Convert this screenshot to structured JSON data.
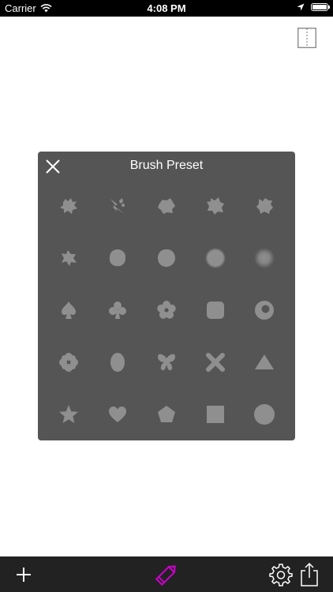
{
  "status_bar": {
    "carrier": "Carrier",
    "time": "4:08 PM"
  },
  "panel": {
    "title": "Brush Preset",
    "close_icon": "close-icon",
    "brushes": [
      "splatter-1",
      "splatter-2",
      "splatter-3",
      "splatter-4",
      "splatter-5",
      "splatter-6",
      "blob-1",
      "blob-2",
      "fuzzy-blob",
      "soft-round",
      "spade",
      "club",
      "flower",
      "rounded-square",
      "ring",
      "clover-cross",
      "oval",
      "butterfly",
      "cross",
      "triangle",
      "star",
      "heart",
      "pentagon",
      "square",
      "circle"
    ]
  },
  "toolbar": {
    "add_icon": "plus-icon",
    "pencil_icon": "pencil-icon",
    "settings_icon": "gear-icon",
    "share_icon": "share-icon",
    "accent_color": "#cc00cc"
  },
  "colors": {
    "panel_bg": "#555555",
    "brush_fill": "#8f8f8f",
    "toolbar_bg": "#222222"
  }
}
